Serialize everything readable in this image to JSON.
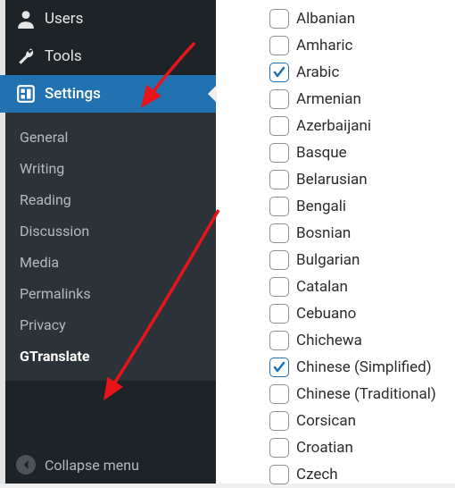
{
  "sidebar": {
    "menu": [
      {
        "label": "Users",
        "icon": "users-icon"
      },
      {
        "label": "Tools",
        "icon": "tools-icon"
      },
      {
        "label": "Settings",
        "icon": "settings-icon"
      }
    ],
    "submenu": [
      {
        "label": "General"
      },
      {
        "label": "Writing"
      },
      {
        "label": "Reading"
      },
      {
        "label": "Discussion"
      },
      {
        "label": "Media"
      },
      {
        "label": "Permalinks"
      },
      {
        "label": "Privacy"
      },
      {
        "label": "GTranslate"
      }
    ],
    "collapse_label": "Collapse menu"
  },
  "languages": [
    {
      "label": "Albanian",
      "checked": false
    },
    {
      "label": "Amharic",
      "checked": false
    },
    {
      "label": "Arabic",
      "checked": true
    },
    {
      "label": "Armenian",
      "checked": false
    },
    {
      "label": "Azerbaijani",
      "checked": false
    },
    {
      "label": "Basque",
      "checked": false
    },
    {
      "label": "Belarusian",
      "checked": false
    },
    {
      "label": "Bengali",
      "checked": false
    },
    {
      "label": "Bosnian",
      "checked": false
    },
    {
      "label": "Bulgarian",
      "checked": false
    },
    {
      "label": "Catalan",
      "checked": false
    },
    {
      "label": "Cebuano",
      "checked": false
    },
    {
      "label": "Chichewa",
      "checked": false
    },
    {
      "label": "Chinese (Simplified)",
      "checked": true
    },
    {
      "label": "Chinese (Traditional)",
      "checked": false
    },
    {
      "label": "Corsican",
      "checked": false
    },
    {
      "label": "Croatian",
      "checked": false
    },
    {
      "label": "Czech",
      "checked": false
    }
  ]
}
